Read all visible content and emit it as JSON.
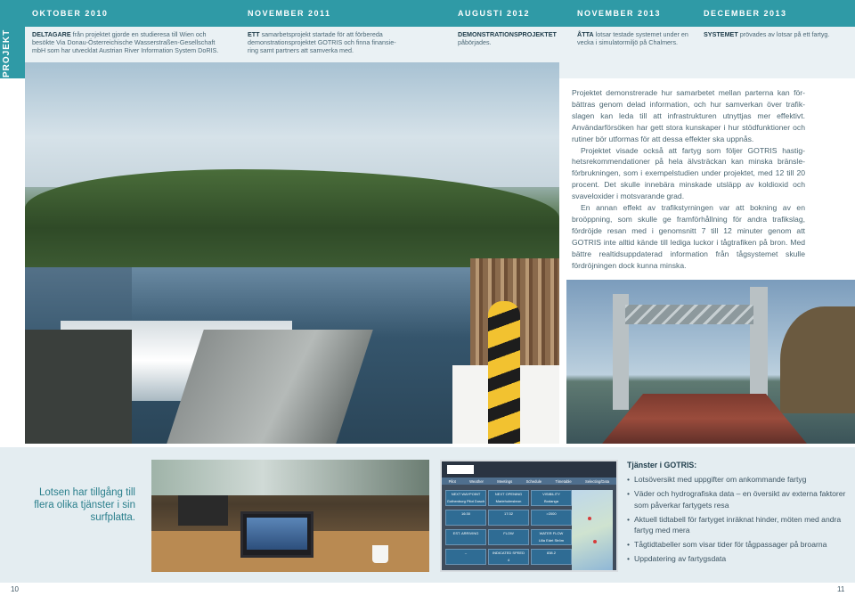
{
  "timeline": {
    "section_label": "PROJEKT",
    "events": [
      {
        "date": "OKTOBER 2010",
        "lead": "DELTAGARE",
        "text": " från projektet gjorde en studieresa till Wien och besökte Via Donau-Österreichische Wasserstraßen-Gesellschaft mbH som har utvecklat Austrian River Information System DoRIS."
      },
      {
        "date": "NOVEMBER 2011",
        "lead": "ETT",
        "text": " samarbetsprojekt startade för att förbereda demonstrationsprojektet GOTRIS och finna finansie-ring samt partners att samverka med."
      },
      {
        "date": "AUGUSTI 2012",
        "lead": "DEMONSTRATIONSPROJEKTET",
        "text": " påbörjades."
      },
      {
        "date": "NOVEMBER 2013",
        "lead": "ÅTTA",
        "text": " lotsar testade systemet under en vecka i simulatormiljö på Chalmers."
      },
      {
        "date": "DECEMBER 2013",
        "lead": "SYSTEMET",
        "text": " prövades av lotsar på ett fartyg."
      }
    ]
  },
  "body": {
    "paragraphs": [
      "Projektet demonstrerade hur samarbetet mellan parterna kan för-bättras genom delad information, och hur samverkan över trafik-slagen kan leda till att infrastrukturen utnyttjas mer effektivt. Användarförsöken har gett stora kunskaper i hur stödfunktioner och rutiner bör utformas för att dessa effekter ska uppnås.",
      "Projektet visade också att fartyg som följer GOTRIS hastig-hetsrekommendationer på hela älvsträckan kan minska bränsle-förbrukningen, som i exempelstudien under projektet, med 12 till 20 procent. Det skulle innebära minskade utsläpp av koldioxid och svaveloxider i motsvarande grad.",
      "En annan effekt av trafikstyrningen var att bokning av en broöppning, som skulle  ge framförhållning för andra trafikslag, fördröjde resan med i genomsnitt 7 till 12 minuter genom att GOTRIS inte alltid kände till lediga luckor i tågtrafiken på bron. Med bättre realtidsuppdaterad information från tågsystemet skulle fördröjningen dock kunna minska."
    ]
  },
  "caption": "Lotsen har tillgång till flera olika tjänster i sin surfplatta.",
  "tablet": {
    "nav": [
      "Pilot",
      "Weather",
      "Meetings",
      "Schedule",
      "Timetable",
      "Selecting/Data"
    ],
    "cells": [
      {
        "label": "NEXT WAYPOINT",
        "value": "Gothenburg Pilot Dusch"
      },
      {
        "label": "NEXT OPENING",
        "value": "Marieholmsbron"
      },
      {
        "label": "VISIBILITY",
        "value": "Bodanga"
      },
      {
        "label": "",
        "value": "16:30"
      },
      {
        "label": "",
        "value": "17:32"
      },
      {
        "label": "",
        "value": ">2000"
      },
      {
        "label": "EST. ARRIVING",
        "value": ""
      },
      {
        "label": "FLOW",
        "value": ""
      },
      {
        "label": "WATER FLOW",
        "value": "Lilla Edet Ström"
      },
      {
        "label": "",
        "value": "–"
      },
      {
        "label": "INDICATED SPEED",
        "value": "4"
      },
      {
        "label": "",
        "value": "838.2"
      }
    ]
  },
  "services": {
    "title": "Tjänster i GOTRIS:",
    "items": [
      "Lotsöversikt med uppgifter om ankommande fartyg",
      "Väder och hydrografiska data – en översikt av externa faktorer som påverkar fartygets resa",
      "Aktuell tidtabell för fartyget inräknat hinder, möten med andra fartyg med mera",
      "Tågtidtabeller som visar tider för tågpassager på broarna",
      "Uppdatering av fartygsdata"
    ]
  },
  "pages": {
    "left": "10",
    "right": "11"
  },
  "colors": {
    "accent": "#2f9aa6",
    "text": "#3d5563",
    "band": "#e4edf1"
  }
}
